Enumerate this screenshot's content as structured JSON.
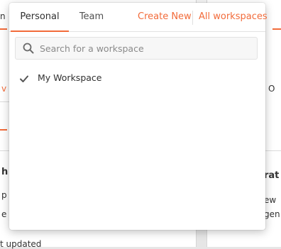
{
  "background": {
    "fragment_top_left": "n",
    "fragment_mid_left": "v",
    "fragment_o": "O",
    "fragment_h": "h",
    "fragment_p": "p",
    "fragment_e": "e",
    "fragment_updated": "t updated",
    "fragment_rat": "rat",
    "fragment_ew": "ew",
    "fragment_gen": "gen",
    "accent_color": "#f26b3a"
  },
  "popover": {
    "tabs": [
      {
        "label": "Personal",
        "active": true
      },
      {
        "label": "Team",
        "active": false
      }
    ],
    "actions": {
      "create_new": "Create New",
      "all_workspaces": "All workspaces"
    },
    "search": {
      "placeholder": "Search for a workspace",
      "value": "",
      "icon": "search-icon"
    },
    "workspaces": [
      {
        "label": "My Workspace",
        "selected": true,
        "icon": "check-icon"
      }
    ]
  }
}
